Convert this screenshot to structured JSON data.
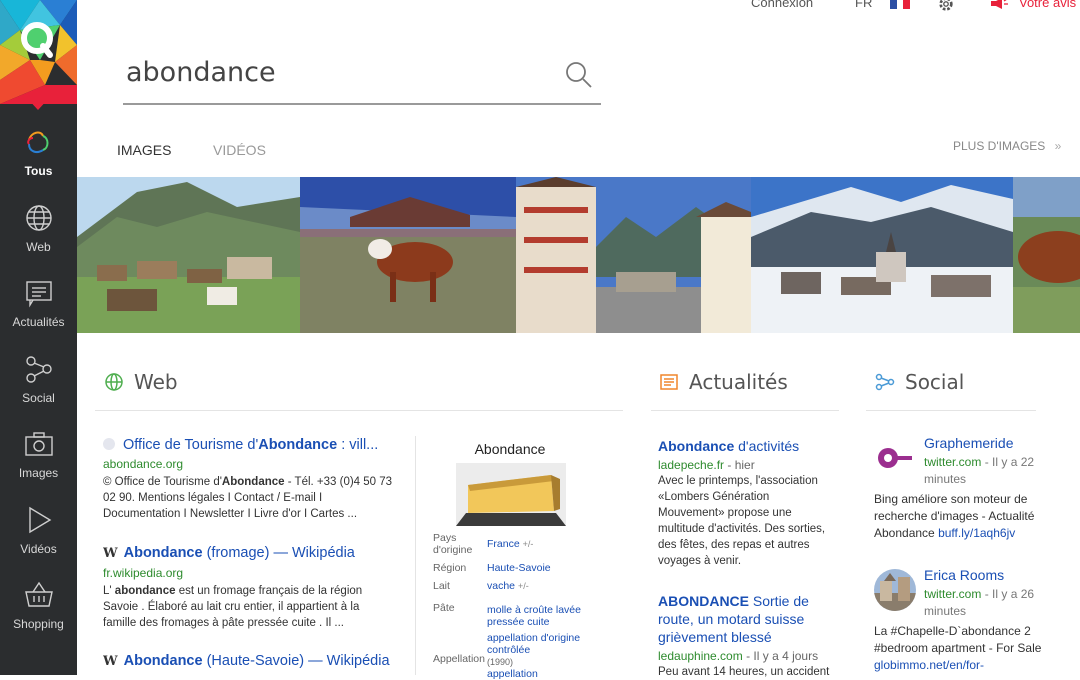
{
  "header": {
    "login": "Connexion",
    "lang": "FR",
    "feedback": "Votre avis"
  },
  "search": {
    "query": "abondance"
  },
  "sidebar": {
    "items": [
      {
        "label": "Tous",
        "icon": "qwant-all-icon",
        "active": true
      },
      {
        "label": "Web",
        "icon": "globe-icon"
      },
      {
        "label": "Actualités",
        "icon": "news-icon"
      },
      {
        "label": "Social",
        "icon": "social-icon"
      },
      {
        "label": "Images",
        "icon": "camera-icon"
      },
      {
        "label": "Vidéos",
        "icon": "play-icon"
      },
      {
        "label": "Shopping",
        "icon": "basket-icon"
      }
    ]
  },
  "tabs": {
    "images": "IMAGES",
    "videos": "VIDÉOS",
    "more": "PLUS D'IMAGES"
  },
  "sections": {
    "web": "Web",
    "news": "Actualités",
    "social": "Social"
  },
  "web_results": [
    {
      "title_pre": "Office de Tourisme d'",
      "title_bold": "Abondance",
      "title_post": " : vill...",
      "url": "abondance.org",
      "desc_pre": "© Office de Tourisme d'",
      "desc_bold": "Abondance",
      "desc_post": " - Tél. +33 (0)4 50 73 02 90. Mentions légales I Contact / E-mail I Documentation I Newsletter I Livre d'or I Cartes ..."
    },
    {
      "title_bold": "Abondance",
      "title_post": " (fromage) — Wikipédia",
      "url": "fr.wikipedia.org",
      "desc_pre": "L' ",
      "desc_bold": "abondance",
      "desc_post": " est un fromage français de la région Savoie . Élaboré au lait cru entier, il appartient à la famille des fromages à pâte pressée cuite . Il ..."
    },
    {
      "title_bold": "Abondance",
      "title_post": " (Haute-Savoie) — Wikipédia"
    }
  ],
  "knowledge": {
    "title": "Abondance",
    "facts": [
      {
        "k": "Pays d'origine",
        "v": "France",
        "extra": "+/-"
      },
      {
        "k": "Région",
        "v": "Haute-Savoie"
      },
      {
        "k": "Lait",
        "v": "vache",
        "extra": "+/-"
      },
      {
        "k": "Pâte",
        "v": "molle à croûte lavée pressée cuite"
      },
      {
        "k": "Appellation",
        "v": "appellation d'origine contrôlée",
        "extra": "(1990)",
        "v2": "appellation"
      }
    ]
  },
  "news": [
    {
      "title_bold": "Abondance",
      "title_post": " d'activités",
      "source": "ladepeche.fr",
      "ago": " - hier",
      "desc": "Avec le printemps, l'association «Lombers Génération Mouvement» propose une multitude d'activités. Des sorties, des fêtes, des repas et autres voyages à venir."
    },
    {
      "title_bold": "ABONDANCE",
      "title_post": " Sortie de route, un motard suisse grièvement blessé",
      "source": "ledauphine.com",
      "ago": " - Il y a 4 jours",
      "desc": "Peu avant 14 heures, un accident"
    }
  ],
  "social": [
    {
      "name": "Graphemeride",
      "source": "twitter.com",
      "ago": " - Il y a 22 minutes",
      "body": "Bing améliore son moteur de recherche d'images - Actualité Abondance ",
      "link": "buff.ly/1aqh6jv"
    },
    {
      "name": "Erica Rooms",
      "source": "twitter.com",
      "ago": " - Il y a 26 minutes",
      "body": "La #Chapelle-D`abondance 2 #bedroom apartment - For Sale ",
      "link": "globimmo.net/en/for-"
    }
  ],
  "colors": {
    "accent_link": "#1a4fb4",
    "url_green": "#2e8b2e",
    "sidebar_bg": "#2b2d2f",
    "logo_red": "#e8213a"
  }
}
